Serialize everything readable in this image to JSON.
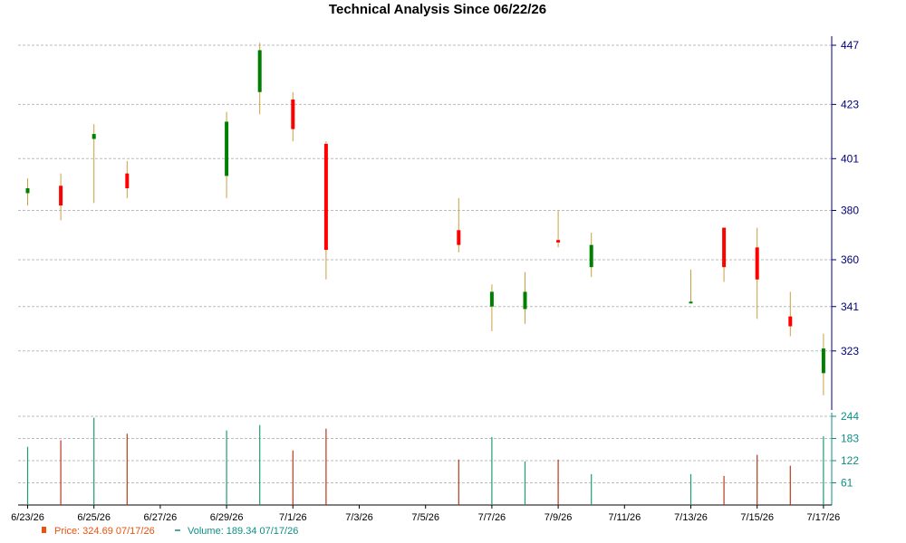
{
  "chart_data": {
    "type": "candlestick",
    "title": "Technical Analysis Since 06/22/26",
    "colors": {
      "up": "#008000",
      "down": "#ff0000",
      "wick": "#c8a040",
      "volume_up": "#1f9d6f",
      "volume_down": "#b53a1c",
      "axis_price": "#00007a",
      "axis_volume": "#0d8f84",
      "grid": "#bbbbbb",
      "legend_price": "#e8530e",
      "legend_volume": "#0d8f84"
    },
    "price_axis": {
      "ticks": [
        323,
        341,
        360,
        380,
        401,
        423,
        447
      ],
      "range": [
        302,
        447
      ]
    },
    "volume_axis": {
      "ticks": [
        61,
        122,
        183,
        244
      ],
      "range": [
        0,
        244
      ]
    },
    "x_tick_labels": [
      "6/23/26",
      "6/25/26",
      "6/27/26",
      "6/29/26",
      "7/1/26",
      "7/3/26",
      "7/5/26",
      "7/7/26",
      "7/9/26",
      "7/11/26",
      "7/13/26",
      "7/15/26",
      "7/17/26"
    ],
    "candles": [
      {
        "date": "6/23/26",
        "open": 387,
        "high": 393,
        "low": 382,
        "close": 389,
        "volume": 160
      },
      {
        "date": "6/24/26",
        "open": 390,
        "high": 395,
        "low": 376,
        "close": 382,
        "volume": 178
      },
      {
        "date": "6/25/26",
        "open": 409,
        "high": 415,
        "low": 383,
        "close": 411,
        "volume": 240
      },
      {
        "date": "6/26/26",
        "open": 395,
        "high": 400,
        "low": 385,
        "close": 389,
        "volume": 196
      },
      {
        "date": "6/29/26",
        "open": 394,
        "high": 420,
        "low": 385,
        "close": 416,
        "volume": 205
      },
      {
        "date": "6/30/26",
        "open": 428,
        "high": 448,
        "low": 419,
        "close": 445,
        "volume": 220
      },
      {
        "date": "7/1/26",
        "open": 425,
        "high": 428,
        "low": 408,
        "close": 413,
        "volume": 150
      },
      {
        "date": "7/2/26",
        "open": 407,
        "high": 408,
        "low": 352,
        "close": 364,
        "volume": 210
      },
      {
        "date": "7/6/26",
        "open": 372,
        "high": 385,
        "low": 363,
        "close": 366,
        "volume": 125
      },
      {
        "date": "7/7/26",
        "open": 341,
        "high": 350,
        "low": 331,
        "close": 347,
        "volume": 187
      },
      {
        "date": "7/8/26",
        "open": 340,
        "high": 355,
        "low": 334,
        "close": 347,
        "volume": 120
      },
      {
        "date": "7/9/26",
        "open": 368,
        "high": 380,
        "low": 365,
        "close": 367,
        "volume": 125
      },
      {
        "date": "7/10/26",
        "open": 357,
        "high": 371,
        "low": 353,
        "close": 366,
        "volume": 85
      },
      {
        "date": "7/13/26",
        "open": 343,
        "high": 356,
        "low": 343,
        "close": 343,
        "volume": 85
      },
      {
        "date": "7/14/26",
        "open": 373,
        "high": 373,
        "low": 351,
        "close": 357,
        "volume": 80
      },
      {
        "date": "7/15/26",
        "open": 365,
        "high": 373,
        "low": 336,
        "close": 352,
        "volume": 138
      },
      {
        "date": "7/16/26",
        "open": 337,
        "high": 347,
        "low": 329,
        "close": 333,
        "volume": 108
      },
      {
        "date": "7/17/26",
        "open": 314,
        "high": 330,
        "low": 305,
        "close": 324,
        "volume": 189
      }
    ],
    "legend": [
      {
        "label": "Price: 324.69  07/17/26",
        "kind": "price"
      },
      {
        "label": "Volume: 189.34  07/17/26",
        "kind": "volume"
      }
    ],
    "grid": true
  }
}
